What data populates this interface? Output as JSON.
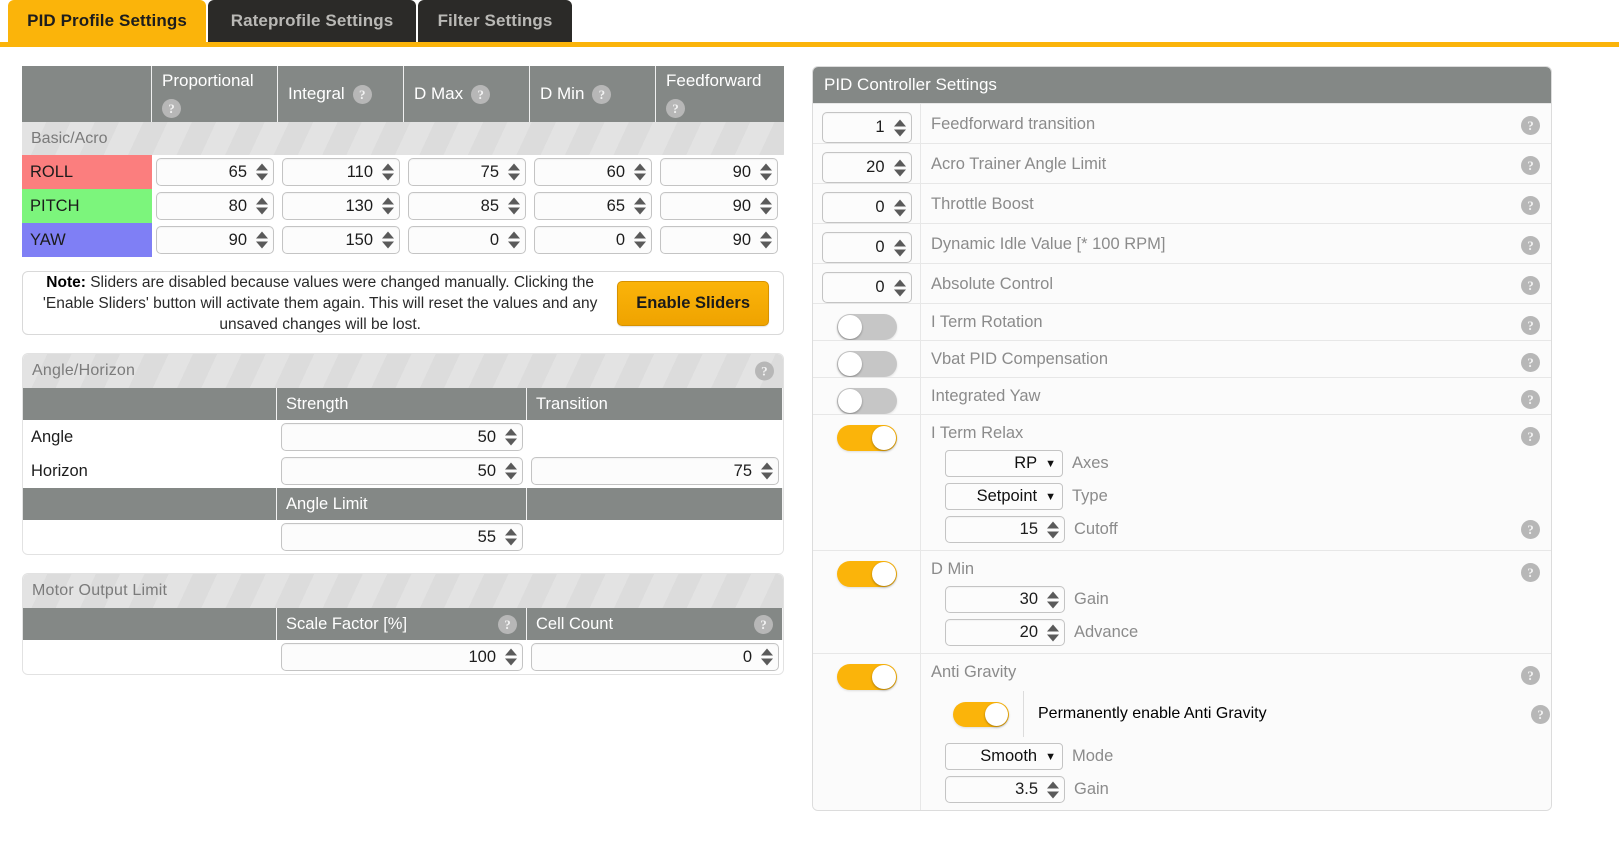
{
  "tabs": [
    {
      "label": "PID Profile Settings",
      "active": true
    },
    {
      "label": "Rateprofile Settings",
      "active": false
    },
    {
      "label": "Filter Settings",
      "active": false
    }
  ],
  "icons": {
    "help": "?",
    "caret_down": "▼"
  },
  "colors": {
    "accent": "#FBB40A",
    "header_grey": "#848886",
    "roll": "#FB7E7E",
    "pitch": "#7CF57C",
    "yaw": "#7F7FF5",
    "tab_inactive": "#2b2a28"
  },
  "pid_table": {
    "columns": [
      "",
      "Proportional",
      "Integral",
      "D Max",
      "D Min",
      "Feedforward"
    ],
    "group_label": "Basic/Acro",
    "rows": [
      {
        "axis": "ROLL",
        "proportional": "65",
        "integral": "110",
        "d_max": "75",
        "d_min": "60",
        "feedforward": "90"
      },
      {
        "axis": "PITCH",
        "proportional": "80",
        "integral": "130",
        "d_max": "85",
        "d_min": "65",
        "feedforward": "90"
      },
      {
        "axis": "YAW",
        "proportional": "90",
        "integral": "150",
        "d_max": "0",
        "d_min": "0",
        "feedforward": "90"
      }
    ]
  },
  "note": {
    "bold": "Note:",
    "text": " Sliders are disabled because values were changed manually. Clicking the 'Enable Sliders' button will activate them again. This will reset the values and any unsaved changes will be lost.",
    "button": "Enable Sliders"
  },
  "angle_horizon": {
    "title": "Angle/Horizon",
    "col_strength": "Strength",
    "col_transition": "Transition",
    "col_angle_limit": "Angle Limit",
    "rows": [
      {
        "label": "Angle",
        "strength": "50",
        "transition": ""
      },
      {
        "label": "Horizon",
        "strength": "50",
        "transition": "75"
      }
    ],
    "angle_limit_value": "55"
  },
  "motor_output_limit": {
    "title": "Motor Output Limit",
    "col_scale_factor": "Scale Factor [%]",
    "col_cell_count": "Cell Count",
    "scale_factor_value": "100",
    "cell_count_value": "0"
  },
  "pid_controller_settings": {
    "title": "PID Controller Settings",
    "rows": [
      {
        "type": "number",
        "value": "1",
        "label": "Feedforward transition"
      },
      {
        "type": "number",
        "value": "20",
        "label": "Acro Trainer Angle Limit"
      },
      {
        "type": "number",
        "value": "0",
        "label": "Throttle Boost"
      },
      {
        "type": "number",
        "value": "0",
        "label": "Dynamic Idle Value [* 100 RPM]"
      },
      {
        "type": "number",
        "value": "0",
        "label": "Absolute Control"
      },
      {
        "type": "toggle",
        "on": false,
        "label": "I Term Rotation"
      },
      {
        "type": "toggle",
        "on": false,
        "label": "Vbat PID Compensation"
      },
      {
        "type": "toggle",
        "on": false,
        "label": "Integrated Yaw"
      }
    ],
    "i_term_relax": {
      "label": "I Term Relax",
      "on": true,
      "axes": {
        "value": "RP",
        "label": "Axes"
      },
      "type_field": {
        "value": "Setpoint",
        "label": "Type"
      },
      "cutoff": {
        "value": "15",
        "label": "Cutoff"
      }
    },
    "d_min": {
      "label": "D Min",
      "on": true,
      "gain": {
        "value": "30",
        "label": "Gain"
      },
      "advance": {
        "value": "20",
        "label": "Advance"
      }
    },
    "anti_gravity": {
      "label": "Anti Gravity",
      "on": true,
      "permanent": {
        "on": true,
        "label": "Permanently enable Anti Gravity"
      },
      "mode": {
        "value": "Smooth",
        "label": "Mode"
      },
      "gain": {
        "value": "3.5",
        "label": "Gain"
      }
    }
  }
}
